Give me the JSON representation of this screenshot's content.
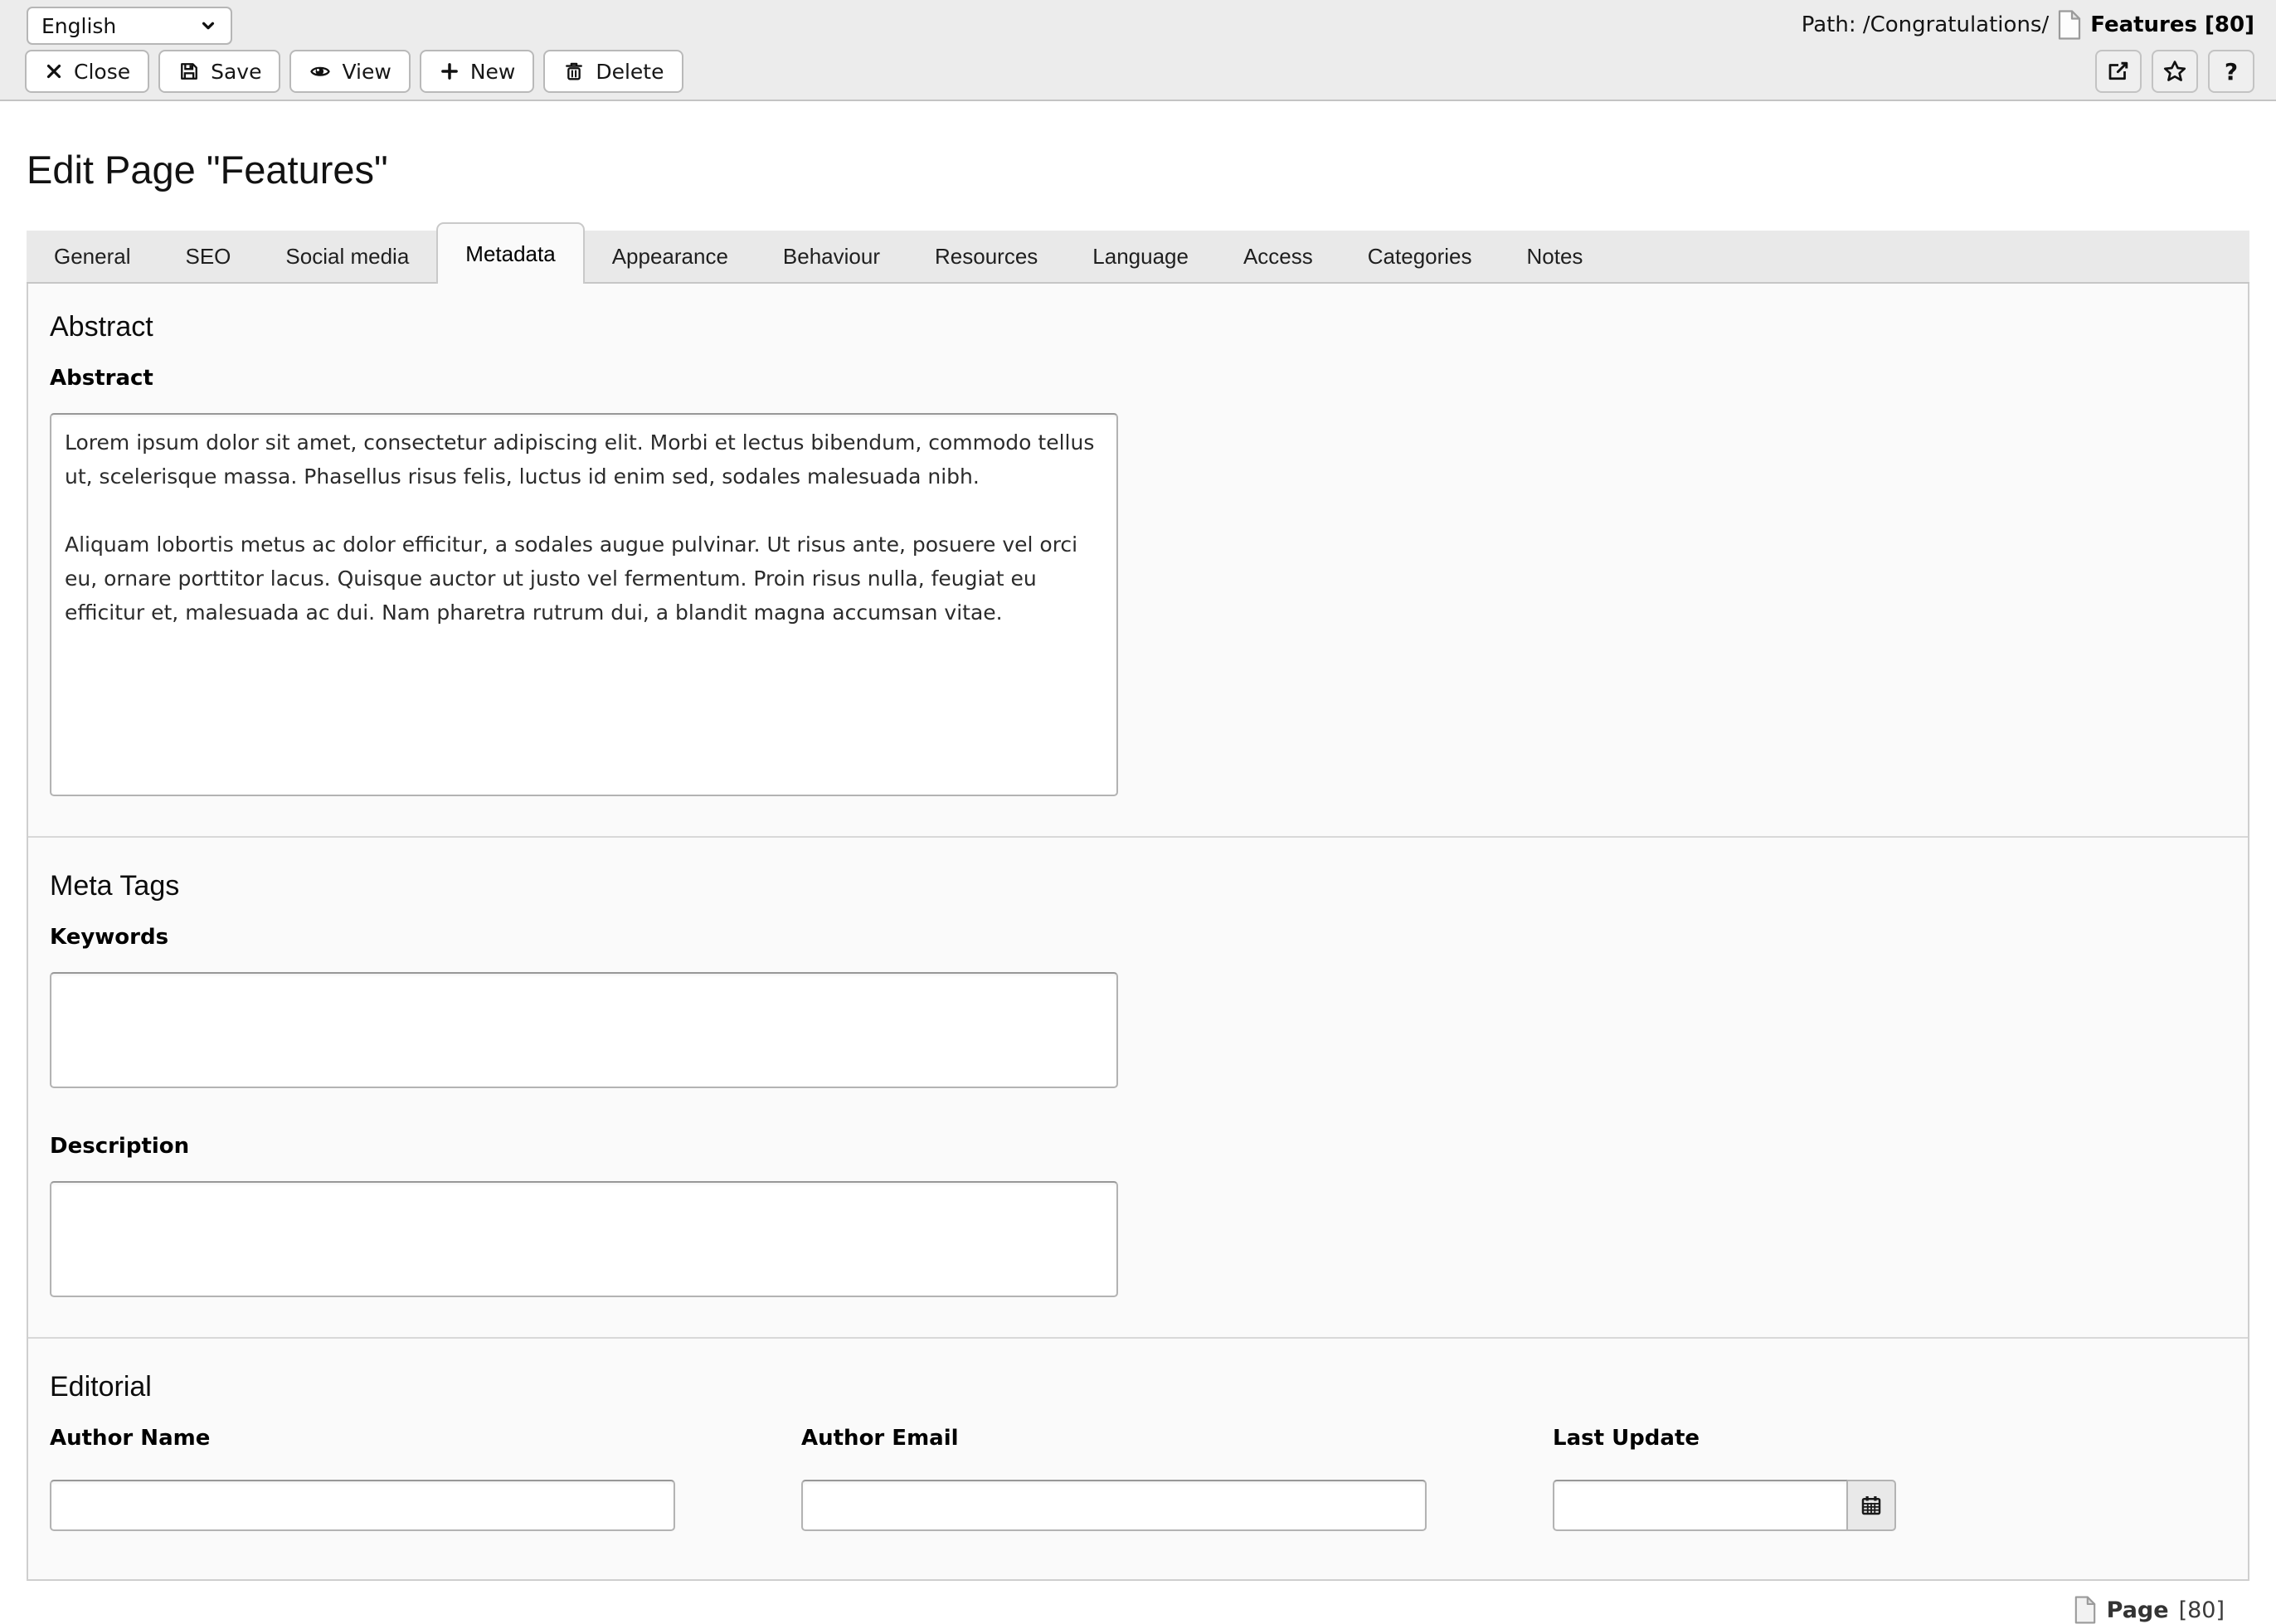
{
  "header": {
    "language_select": {
      "value": "English"
    },
    "path": {
      "label": "Path: /Congratulations/",
      "page_ref": "Features [80]"
    },
    "toolbar": {
      "close": "Close",
      "save": "Save",
      "view": "View",
      "new": "New",
      "delete": "Delete"
    },
    "help_button": "?"
  },
  "page_title": "Edit Page \"Features\"",
  "tabs": {
    "active": "Metadata",
    "items": [
      "General",
      "SEO",
      "Social media",
      "Metadata",
      "Appearance",
      "Behaviour",
      "Resources",
      "Language",
      "Access",
      "Categories",
      "Notes"
    ]
  },
  "abstract_section": {
    "heading": "Abstract",
    "abstract_label": "Abstract",
    "abstract_value": "Lorem ipsum dolor sit amet, consectetur adipiscing elit. Morbi et lectus bibendum, commodo tellus ut, scelerisque massa. Phasellus risus felis, luctus id enim sed, sodales malesuada nibh.\n\nAliquam lobortis metus ac dolor efficitur, a sodales augue pulvinar. Ut risus ante, posuere vel orci eu, ornare porttitor lacus. Quisque auctor ut justo vel fermentum. Proin risus nulla, feugiat eu efficitur et, malesuada ac dui. Nam pharetra rutrum dui, a blandit magna accumsan vitae."
  },
  "meta_tags_section": {
    "heading": "Meta Tags",
    "keywords_label": "Keywords",
    "keywords_value": "",
    "description_label": "Description",
    "description_value": ""
  },
  "editorial_section": {
    "heading": "Editorial",
    "author_name_label": "Author Name",
    "author_name_value": "",
    "author_email_label": "Author Email",
    "author_email_value": "",
    "last_update_label": "Last Update",
    "last_update_value": ""
  },
  "footer": {
    "doc_type": "Page",
    "doc_id": "[80]"
  },
  "colors": {
    "header_bg": "#ececec",
    "tabbar_bg": "#e9e9e9",
    "panel_bg": "#fafafa",
    "border": "#c9c9c9",
    "field_border": "#b3b3b3"
  }
}
